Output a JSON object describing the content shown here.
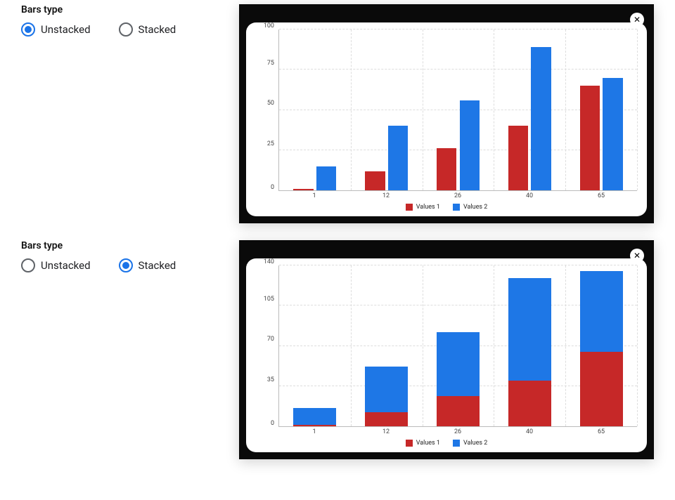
{
  "controls": {
    "title": "Bars type",
    "options": {
      "unstacked": "Unstacked",
      "stacked": "Stacked"
    }
  },
  "close_glyph": "✕",
  "chart_data": [
    {
      "id": "grouped",
      "type": "bar",
      "stacked": false,
      "categories": [
        "1",
        "12",
        "26",
        "40",
        "65"
      ],
      "series": [
        {
          "name": "Values 1",
          "values": [
            1,
            12,
            26,
            40,
            65
          ]
        },
        {
          "name": "Values 2",
          "values": [
            15,
            40,
            56,
            89,
            70
          ]
        }
      ],
      "ylim": [
        0,
        100
      ],
      "yticks": [
        0,
        25,
        50,
        75,
        100
      ],
      "xlabel": "",
      "ylabel": "",
      "legend": [
        "Values 1",
        "Values 2"
      ]
    },
    {
      "id": "stacked",
      "type": "bar",
      "stacked": true,
      "categories": [
        "1",
        "12",
        "26",
        "40",
        "65"
      ],
      "series": [
        {
          "name": "Values 1",
          "values": [
            1,
            12,
            26,
            40,
            65
          ]
        },
        {
          "name": "Values 2",
          "values": [
            15,
            40,
            56,
            89,
            70
          ]
        }
      ],
      "ylim": [
        0,
        140
      ],
      "yticks": [
        0,
        35,
        70,
        105,
        140
      ],
      "xlabel": "",
      "ylabel": "",
      "legend": [
        "Values 1",
        "Values 2"
      ]
    }
  ],
  "rows": [
    {
      "selected": "unstacked",
      "chart": "grouped"
    },
    {
      "selected": "stacked",
      "chart": "stacked"
    }
  ],
  "colors": {
    "series0": "#c62828",
    "series1": "#1e77e6",
    "accent": "#1a73e8"
  }
}
